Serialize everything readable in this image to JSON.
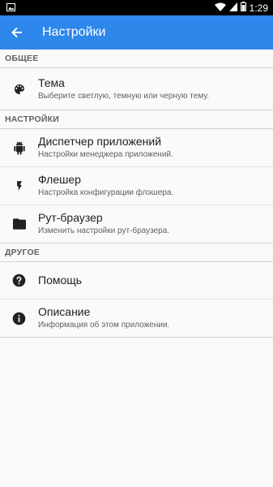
{
  "status_bar": {
    "time": "1:29"
  },
  "app_bar": {
    "title": "Настройки"
  },
  "sections": [
    {
      "header": "ОБЩЕЕ",
      "items": [
        {
          "title": "Тема",
          "summary": "Выберите светлую, темную или черную тему.",
          "icon": "palette-icon"
        }
      ]
    },
    {
      "header": "НАСТРОЙКИ",
      "items": [
        {
          "title": "Диспетчер приложений",
          "summary": "Настройки менеджера приложений.",
          "icon": "android-icon"
        },
        {
          "title": "Флешер",
          "summary": "Настройка конфигурации флэшера.",
          "icon": "flash-icon"
        },
        {
          "title": "Рут-браузер",
          "summary": "Изменить настройки рут-браузера.",
          "icon": "folder-icon"
        }
      ]
    },
    {
      "header": "ДРУГОЕ",
      "items": [
        {
          "title": "Помощь",
          "summary": "",
          "icon": "help-icon"
        },
        {
          "title": "Описание",
          "summary": "Информация об этом приложении.",
          "icon": "info-icon"
        }
      ]
    }
  ],
  "colors": {
    "app_bar": "#2e87ea",
    "background": "#fafafa"
  }
}
